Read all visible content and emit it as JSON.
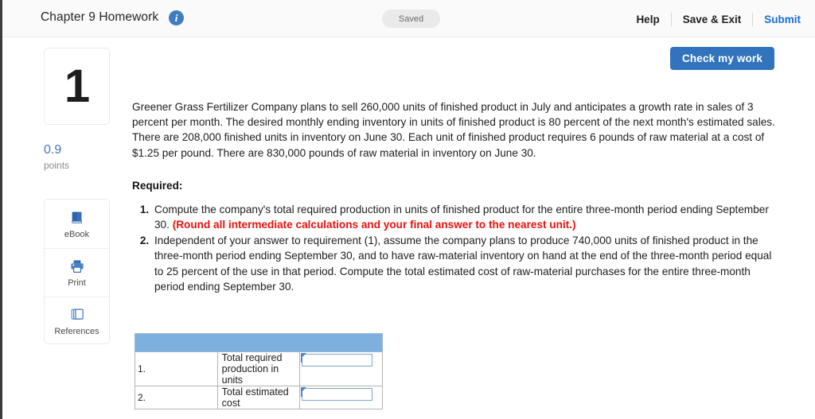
{
  "topbar": {
    "title": "Chapter 9 Homework",
    "info_icon": "info-icon",
    "saved_label": "Saved",
    "help_label": "Help",
    "save_exit_label": "Save & Exit",
    "submit_label": "Submit",
    "submit_color": "#1a6fd4"
  },
  "sidebar": {
    "question_number": "1",
    "points_value": "0.9",
    "points_label": "points",
    "points_color": "#4878b4",
    "tools": [
      {
        "label": "eBook",
        "icon": "book-icon"
      },
      {
        "label": "Print",
        "icon": "printer-icon"
      },
      {
        "label": "References",
        "icon": "copy-pages-icon"
      }
    ]
  },
  "actions": {
    "check_my_work_label": "Check my work",
    "check_my_work_color": "#3273bd"
  },
  "question": {
    "body": "Greener Grass Fertilizer Company plans to sell 260,000 units of finished product in July and anticipates a growth rate in sales of 3 percent per month. The desired monthly ending inventory in units of finished product is 80 percent of the next month's estimated sales. There are 208,000 finished units in inventory on June 30. Each unit of finished product requires 6 pounds of raw material at a cost of $1.25 per pound. There are 830,000 pounds of raw material in inventory on June 30.",
    "required_heading": "Required:",
    "requirements": [
      {
        "text": "Compute the company's total required production in units of finished product for the entire three-month period ending September 30. ",
        "note": "(Round all intermediate calculations and your final answer to the nearest unit.)",
        "note_color": "#e8120e"
      },
      {
        "text": "Independent of your answer to requirement (1), assume the company plans to produce 740,000 units of finished product in the three-month period ending September 30, and to have raw-material inventory on hand at the end of the three-month period equal to 25 percent of the use in that period. Compute the total estimated cost of raw-material purchases for the entire three-month period ending September 30.",
        "note": "",
        "note_color": ""
      }
    ]
  },
  "answer_table": {
    "header_color": "#7eb0dd",
    "rows": [
      {
        "num": "1.",
        "label": "Total required production in units",
        "value": "",
        "placeholder": ""
      },
      {
        "num": "2.",
        "label": "Total estimated cost",
        "value": "",
        "placeholder": ""
      }
    ]
  }
}
